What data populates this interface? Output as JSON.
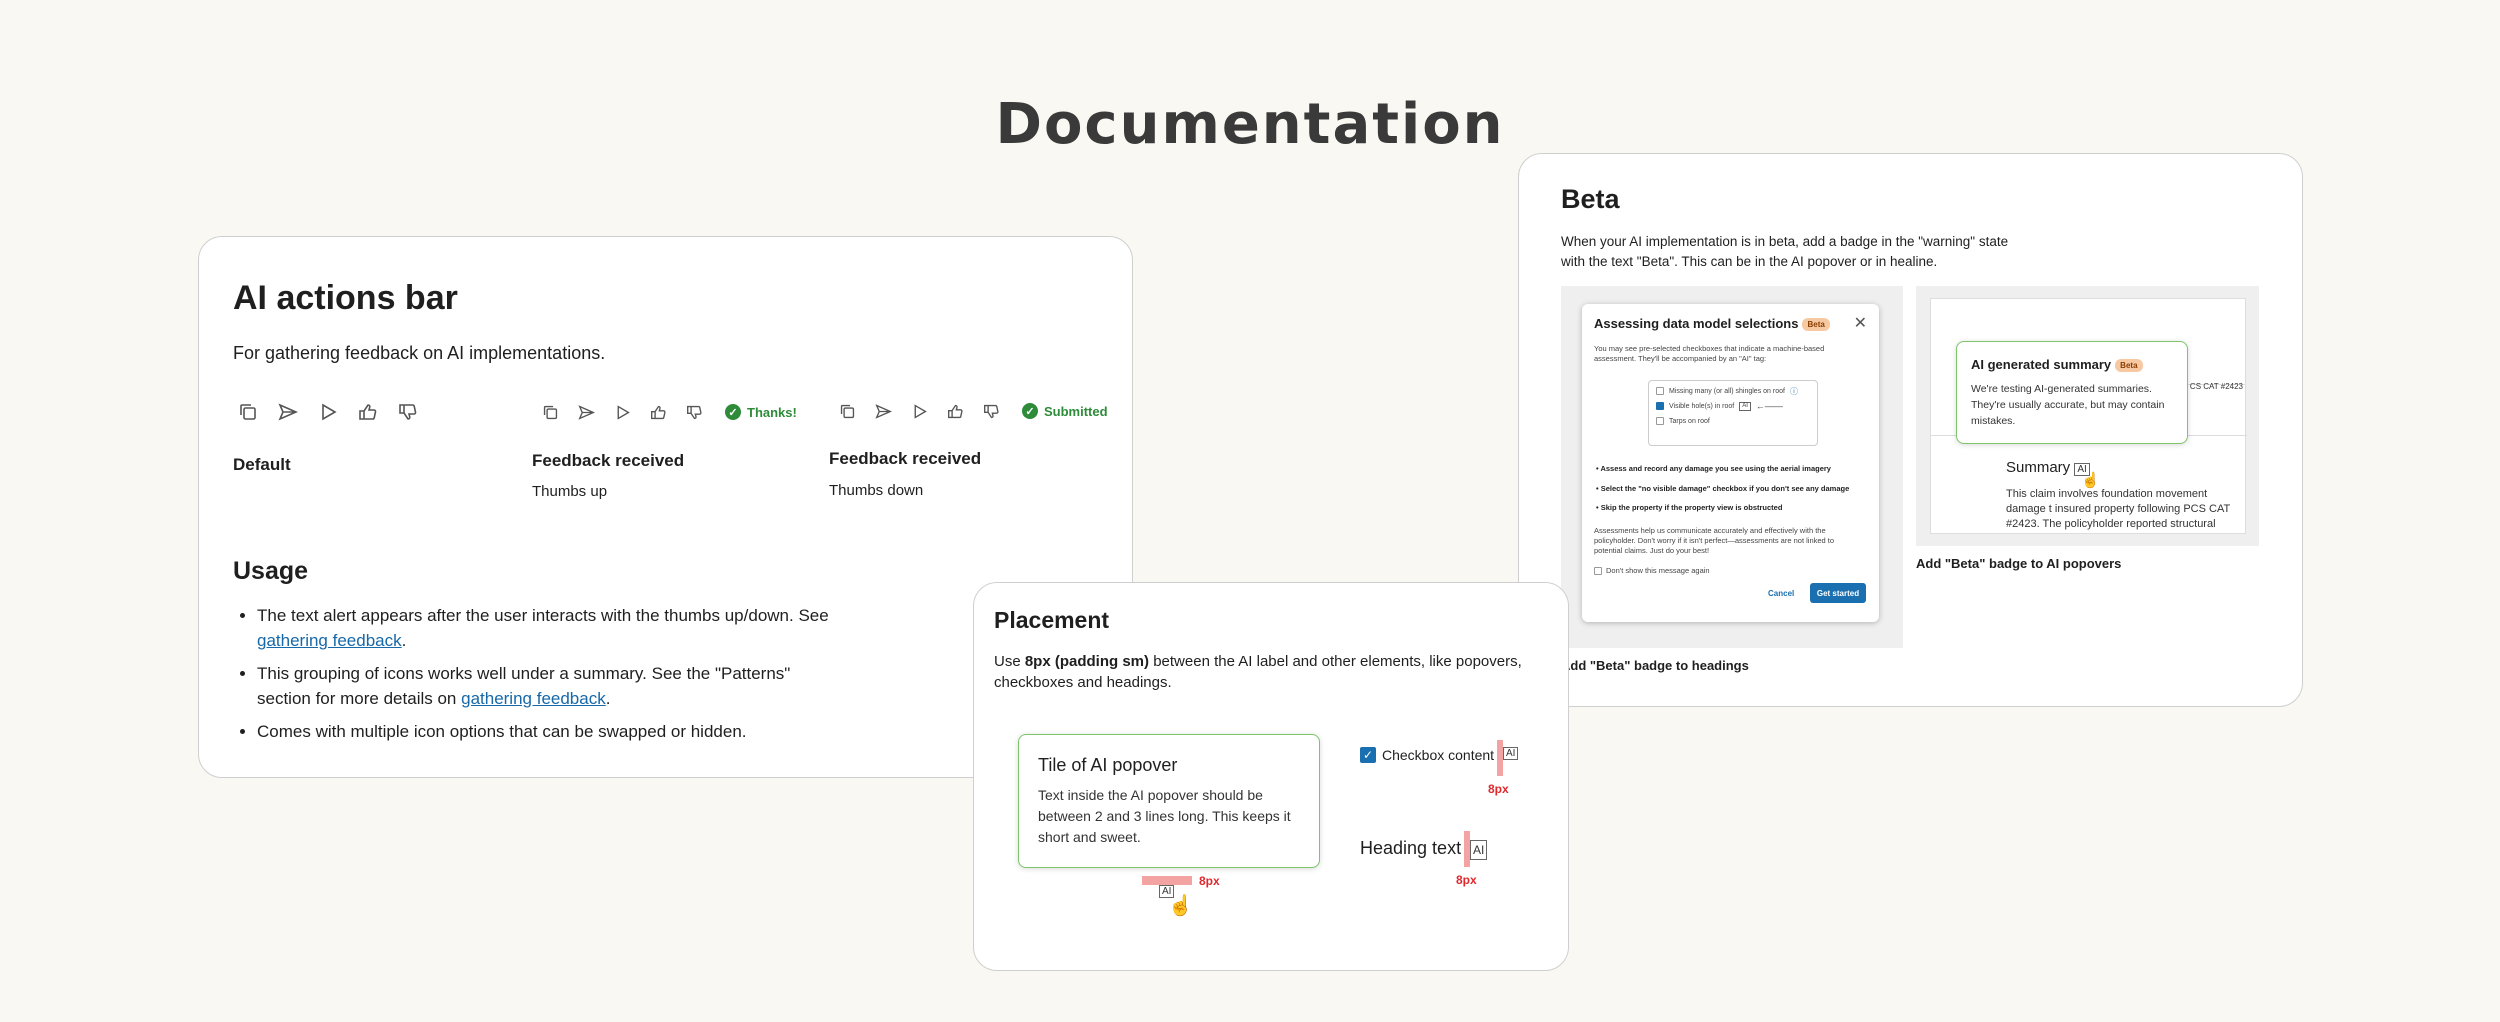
{
  "page": {
    "title": "Documentation"
  },
  "ai_actions": {
    "title": "AI actions bar",
    "description": "For gathering feedback on AI implementations.",
    "variants": [
      {
        "title": "Default",
        "subtitle": "",
        "status": ""
      },
      {
        "title": "Feedback received",
        "subtitle": "Thumbs up",
        "status": "Thanks!"
      },
      {
        "title": "Feedback received",
        "subtitle": "Thumbs down",
        "status": "Submitted"
      }
    ],
    "icons": [
      "copy-icon",
      "send-icon",
      "play-icon",
      "thumbs-up-icon",
      "thumbs-down-icon"
    ],
    "usage_title": "Usage",
    "usage": [
      {
        "text": "The text alert appears after the user interacts with the thumbs up/down. See ",
        "link": "gathering feedback",
        "end": "."
      },
      {
        "text": "This grouping of icons works well under a summary. See the \"Patterns\" section for more details on ",
        "link": "gathering feedback",
        "end": "."
      },
      {
        "text": "Comes with multiple icon options that can be swapped or hidden.",
        "link": "",
        "end": ""
      }
    ],
    "colors": {
      "status_green": "#2e8b3a",
      "link": "#1668a8"
    }
  },
  "beta": {
    "title": "Beta",
    "description": "When your AI implementation is in beta, add a badge in the \"warning\" state with the text \"Beta\". This can be in the AI popover or in healine.",
    "modal": {
      "title": "Assessing data model selections",
      "badge": "Beta",
      "intro": "You may see pre-selected checkboxes that indicate a machine-based assessment. They'll be accompanied by an \"AI\" tag:",
      "checkboxes": [
        "Missing many (or all) shingles on roof",
        "Visible hole(s) in roof",
        "Tarps on roof"
      ],
      "ai_tag": "AI",
      "bullets": [
        "Assess and record any damage you see using the aerial imagery",
        "Select the \"no visible damage\" checkbox if you don't see any damage",
        "Skip the property if the property view is obstructed"
      ],
      "footer": "Assessments help us communicate accurately and effectively with the policyholder. Don't worry if it isn't perfect—assessments are not linked to potential claims. Just do your best!",
      "dont_show": "Don't show this message again",
      "cancel": "Cancel",
      "start": "Get started"
    },
    "caption_headings": "Add \"Beta\" badge to headings",
    "popover": {
      "title": "AI generated summary",
      "badge": "Beta",
      "body": "We're testing AI-generated summaries. They're usually accurate, but may contain mistakes.",
      "summary_heading": "Summary",
      "ai_tag": "AI",
      "claim_ref": "CS CAT #2423",
      "summary_text": "This claim involves foundation movement damage t insured property following PCS CAT #2423. The policyholder reported structural issues including visi"
    },
    "caption_popovers": "Add \"Beta\" badge to AI popovers"
  },
  "placement": {
    "title": "Placement",
    "desc_prefix": "Use ",
    "desc_bold": "8px (padding sm)",
    "desc_suffix": " between the AI label and other elements, like popovers, checkboxes and headings.",
    "popover_title": "Tile of AI popover",
    "popover_body": "Text inside the AI popover should be between 2 and 3 lines long. This keeps it short and sweet.",
    "checkbox_label": "Checkbox content",
    "heading_text": "Heading text",
    "ai_tag": "AI",
    "spacing_label": "8px",
    "colors": {
      "spacing_red": "#e0282d",
      "popover_green": "#7dc46a"
    }
  }
}
